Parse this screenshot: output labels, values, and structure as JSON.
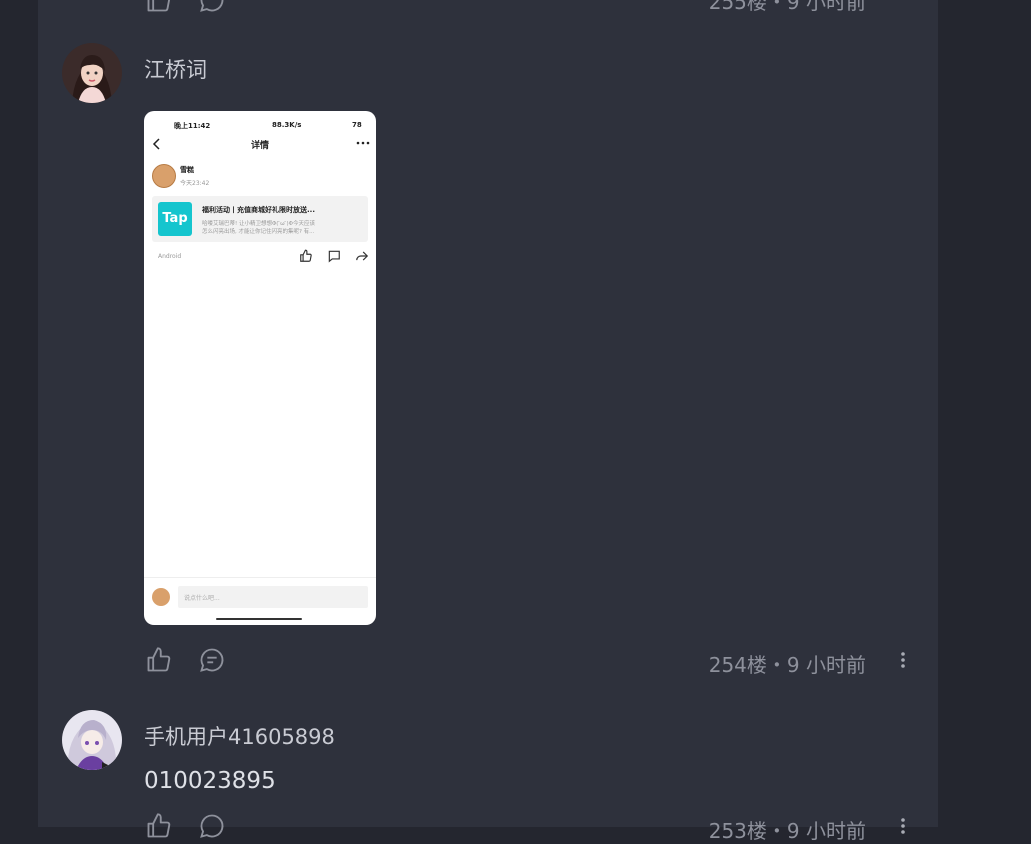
{
  "comments": [
    {
      "username": "江桥词",
      "phone": {
        "status_time": "晚上11:42",
        "status_right": "88.3K/s",
        "battery": "78",
        "header_title": "详情",
        "post_author": "雪糕",
        "post_time": "今天23:42",
        "card_logo": "Tap",
        "card_title": "福利活动丨充值商城好礼限时放送...",
        "card_line1": "哈喽艾瑞巴蒂! 让小精卫想想Φ( ̄ω ̄)Φ今天应该",
        "card_line2": "怎么闪亮出场, 才能让你记住闪亮的集呢? 有...",
        "device": "Android",
        "input_placeholder": "说点什么吧..."
      },
      "meta": "254楼・9 小时前"
    },
    {
      "username": "手机用户41605898",
      "text": "010023895",
      "meta": "253楼・9 小时前"
    }
  ],
  "top_partial_meta": "255楼・9 小时前",
  "colors": {
    "page_bg": "#24262f",
    "panel_bg": "#2e313c",
    "text_primary": "#dfe1e7",
    "text_secondary": "#8e919c",
    "tap_brand": "#15c5ce"
  },
  "icons": [
    "thumbs-up-icon",
    "comment-icon",
    "more-vertical-icon",
    "back-arrow-icon",
    "more-horizontal-icon",
    "share-icon"
  ]
}
